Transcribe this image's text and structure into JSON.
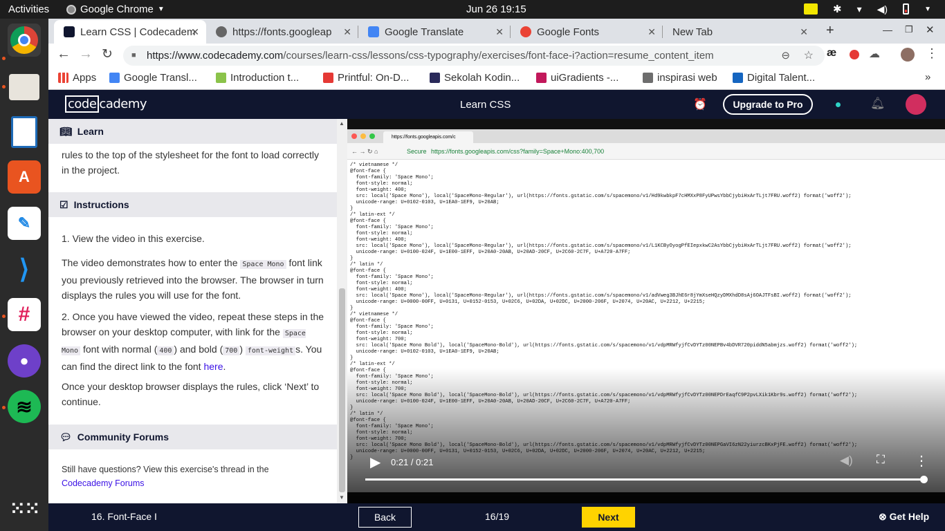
{
  "system": {
    "activities": "Activities",
    "app_name": "Google Chrome",
    "clock": "Jun 26  19:15"
  },
  "browser": {
    "tabs": [
      {
        "label": "Learn CSS | Codecadem",
        "color": "#ffffff"
      },
      {
        "label": "https://fonts.googleap",
        "color": "#555555"
      },
      {
        "label": "Google Translate",
        "color": "#4285f4"
      },
      {
        "label": "Google Fonts",
        "color": "#ea4335"
      },
      {
        "label": "New Tab",
        "color": "#ffffff"
      }
    ],
    "url_domain": "https://www.codecademy.com",
    "url_path": "/courses/learn-css/lessons/css-typography/exercises/font-face-i?action=resume_content_item",
    "bookmarks": [
      {
        "label": "Apps",
        "color": "#ea4335"
      },
      {
        "label": "Google Transl...",
        "color": "#4285f4"
      },
      {
        "label": "Introduction t...",
        "color": "#8bc34a"
      },
      {
        "label": "Printful: On-D...",
        "color": "#e53935"
      },
      {
        "label": "Sekolah Kodin...",
        "color": "#2a2a5a"
      },
      {
        "label": "uiGradients -...",
        "color": "#c2185b"
      },
      {
        "label": "inspirasi web",
        "color": "#6d6d6d"
      },
      {
        "label": "Digital Talent...",
        "color": "#1565c0"
      }
    ]
  },
  "header": {
    "logo_box": "code",
    "logo_rest": "cademy",
    "title": "Learn CSS",
    "upgrade": "Upgrade to Pro"
  },
  "learn": {
    "heading": "Learn",
    "text": "rules to the top of the stylesheet for the font to load correctly in the project."
  },
  "instructions": {
    "heading": "Instructions",
    "step1": "1. View the video in this exercise.",
    "p1_a": "The video demonstrates how to enter the ",
    "p1_code": "Space Mono",
    "p1_b": " font link you previously retrieved into the browser. The browser in turn displays the rules you will use for the font.",
    "p2_a": "2. Once you have viewed the video, repeat these steps in the browser on your desktop computer, with link for the ",
    "p2_code1": "Space Mono",
    "p2_b": " font with normal (",
    "p2_code2": "400",
    "p2_c": ") and bold (",
    "p2_code3": "700",
    "p2_d": ") ",
    "p2_code4": "font-weight",
    "p2_e": "s. You can find the direct link to the font ",
    "p2_link": "here",
    "p2_f": ".",
    "p3": "Once your desktop browser displays the rules, click ‘Next’ to continue."
  },
  "forums": {
    "heading": "Community Forums",
    "text": "Still have questions? View this exercise's thread in the",
    "link": "Codecademy Forums"
  },
  "video": {
    "inner_tab": "https://fonts.googleapis.com/c",
    "inner_secure": "Secure",
    "inner_url": "https://fonts.googleapis.com/css?family=Space+Mono:400,700",
    "css_text": "/* vietnamese */\n@font-face {\n  font-family: 'Space Mono';\n  font-style: normal;\n  font-weight: 400;\n  src: local('Space Mono'), local('SpaceMono-Regular'), url(https://fonts.gstatic.com/s/spacemono/v1/Hd9kwbkpF7cHMXxP8FyUPwsYbbCjybiHxArTLjt7FRU.woff2) format('woff2');\n  unicode-range: U+0102-0103, U+1EA0-1EF9, U+20AB;\n}\n/* latin-ext */\n@font-face {\n  font-family: 'Space Mono';\n  font-style: normal;\n  font-weight: 400;\n  src: local('Space Mono'), local('SpaceMono-Regular'), url(https://fonts.gstatic.com/s/spacemono/v1/L1KCByOyogPfEIepxkwC2AsYbbCjybiHxArTLjt7FRU.woff2) format('woff2');\n  unicode-range: U+0100-024F, U+1E00-1EFF, U+20A0-20AB, U+20AD-20CF, U+2C60-2C7F, U+A720-A7FF;\n}\n/* latin */\n@font-face {\n  font-family: 'Space Mono';\n  font-style: normal;\n  font-weight: 400;\n  src: local('Space Mono'), local('SpaceMono-Regular'), url(https://fonts.gstatic.com/s/spacemono/v1/adVweg3BJhE6r8jYmXseHQzyDMXhdD8sAj6OAJTFsBI.woff2) format('woff2');\n  unicode-range: U+0000-00FF, U+0131, U+0152-0153, U+02C6, U+02DA, U+02DC, U+2000-206F, U+2074, U+20AC, U+2212, U+2215;\n}\n/* vietnamese */\n@font-face {\n  font-family: 'Space Mono';\n  font-style: normal;\n  font-weight: 700;\n  src: local('Space Mono Bold'), local('SpaceMono-Bold'), url(https://fonts.gstatic.com/s/spacemono/v1/vdpMRWfyjfCvDYTz00NEPBv4bDVR720piddN5abmjzs.woff2) format('woff2');\n  unicode-range: U+0102-0103, U+1EA0-1EF9, U+20AB;\n}\n/* latin-ext */\n@font-face {\n  font-family: 'Space Mono';\n  font-style: normal;\n  font-weight: 700;\n  src: local('Space Mono Bold'), local('SpaceMono-Bold'), url(https://fonts.gstatic.com/s/spacemono/v1/vdpMRWfyjfCvDYTz00NEPDrEaqfC9P2pvLXik1Kbr9s.woff2) format('woff2');\n  unicode-range: U+0100-024F, U+1E00-1EFF, U+20A0-20AB, U+20AD-20CF, U+2C60-2C7F, U+A720-A7FF;\n}\n/* latin */\n@font-face {\n  font-family: 'Space Mono';\n  font-style: normal;\n  font-weight: 700;\n  src: local('Space Mono Bold'), local('SpaceMono-Bold'), url(https://fonts.gstatic.com/s/spacemono/v1/vdpMRWfyjfCvDYTz00NEPGaVI6zN22yiurzcBKxPjFE.woff2) format('woff2');\n  unicode-range: U+0000-00FF, U+0131, U+0152-0153, U+02C6, U+02DA, U+02DC, U+2000-206F, U+2074, U+20AC, U+2212, U+2215;\n}",
    "time": "0:21 / 0:21",
    "progress": 1.0
  },
  "footer": {
    "lesson": "16. Font-Face I",
    "back": "Back",
    "pages": "16/19",
    "next": "Next",
    "help": "Get Help"
  },
  "colors": {
    "navy": "#10162f",
    "yellow": "#ffd300",
    "link": "#3a10e5"
  }
}
